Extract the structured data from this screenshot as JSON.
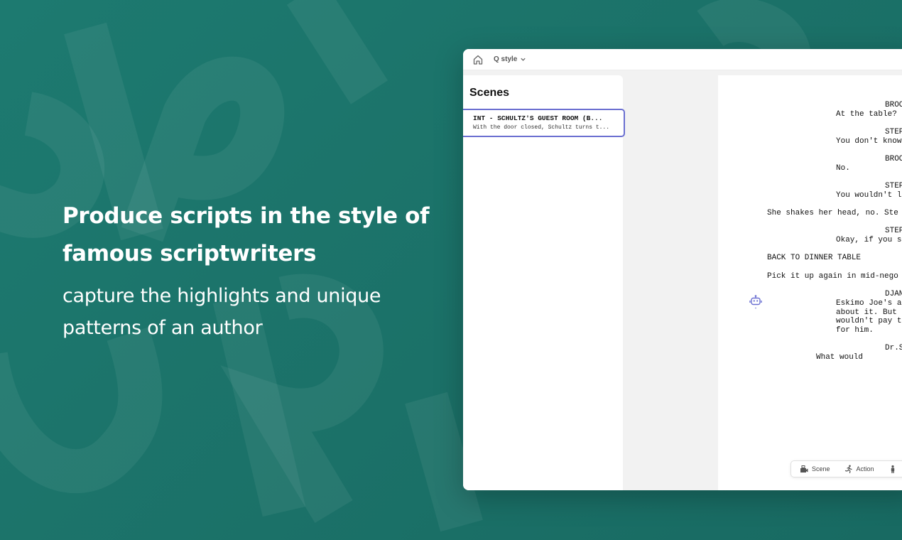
{
  "hero": {
    "headline": "Produce scripts in the style of famous scriptwriters",
    "subheadline": "capture the highlights and unique patterns of an author"
  },
  "topbar": {
    "home_icon": "home-icon",
    "project_name": "Q style",
    "dropdown_icon": "chevron-down-icon"
  },
  "scenes": {
    "title": "Scenes",
    "items": [
      {
        "heading": "INT - SCHULTZ'S GUEST ROOM (B...",
        "description": "With the door closed, Schultz turns t..."
      }
    ]
  },
  "script": {
    "lines": [
      "BROO",
      "At the table?",
      "STEP",
      "You don't know",
      "BROO",
      "No.",
      "STEP",
      "You wouldn't l",
      "She shakes her head, no. Ste",
      "STEP",
      "Okay, if you s",
      "BACK TO DINNER TABLE",
      "Pick it up again in mid-nego",
      "DJAN",
      "Eskimo Joe's a",
      "about it. But",
      "wouldn't pay t",
      "for him.",
      "Dr.S",
      "What would"
    ]
  },
  "assistant": {
    "icon": "robot-icon"
  },
  "toolbar": {
    "items": [
      {
        "label": "Scene",
        "icon": "scene-icon"
      },
      {
        "label": "Action",
        "icon": "running-person-icon"
      }
    ]
  },
  "colors": {
    "background": "#1b7168",
    "accent": "#6a6fd1"
  }
}
